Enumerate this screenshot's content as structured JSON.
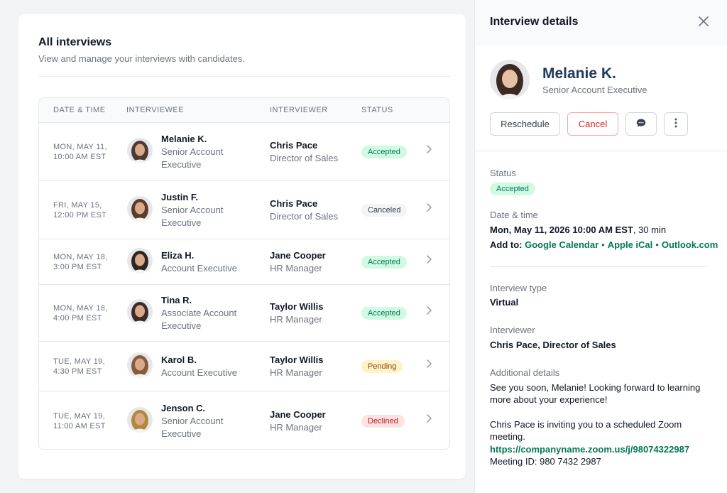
{
  "list": {
    "title": "All interviews",
    "subtitle": "View and manage your interviews with candidates.",
    "columns": [
      "DATE & TIME",
      "INTERVIEWEE",
      "INTERVIEWER",
      "STATUS"
    ],
    "rows": [
      {
        "date1": "MON, MAY 11,",
        "date2": "10:00 AM EST",
        "interviewee": "Melanie K.",
        "role1": "Senior Account",
        "role2": "Executive",
        "interviewer": "Chris Pace",
        "interviewer_role": "Director of Sales",
        "status": "Accepted",
        "avatar_bg": "#4b3a33"
      },
      {
        "date1": "FRI, MAY 15,",
        "date2": "12:00 PM EST",
        "interviewee": "Justin F.",
        "role1": "Senior Account",
        "role2": "Executive",
        "interviewer": "Chris Pace",
        "interviewer_role": "Director of Sales",
        "status": "Canceled",
        "avatar_bg": "#5b3b2a"
      },
      {
        "date1": "MON, MAY 18,",
        "date2": "3:00 PM EST",
        "interviewee": "Eliza H.",
        "role1": "Account Executive",
        "role2": "",
        "interviewer": "Jane Cooper",
        "interviewer_role": "HR Manager",
        "status": "Accepted",
        "avatar_bg": "#2f2522"
      },
      {
        "date1": "MON, MAY 18,",
        "date2": "4:00 PM EST",
        "interviewee": "Tina R.",
        "role1": "Associate Account",
        "role2": "Executive",
        "interviewer": "Taylor Willis",
        "interviewer_role": "HR Manager",
        "status": "Accepted",
        "avatar_bg": "#3a2d28"
      },
      {
        "date1": "TUE, MAY 19,",
        "date2": "4:30 PM EST",
        "interviewee": "Karol B.",
        "role1": "Account Executive",
        "role2": "",
        "interviewer": "Taylor Willis",
        "interviewer_role": "HR Manager",
        "status": "Pending",
        "avatar_bg": "#8a5a3c"
      },
      {
        "date1": "TUE, MAY 19,",
        "date2": "11:00 AM EST",
        "interviewee": "Jenson C.",
        "role1": "Senior Account",
        "role2": "Executive",
        "interviewer": "Jane Cooper",
        "interviewer_role": "HR Manager",
        "status": "Declined",
        "avatar_bg": "#b08a3a"
      }
    ]
  },
  "panel": {
    "title": "Interview details",
    "name": "Melanie K.",
    "role": "Senior Account Executive",
    "buttons": {
      "reschedule": "Reschedule",
      "cancel": "Cancel"
    },
    "status_label": "Status",
    "status_value": "Accepted",
    "datetime_label": "Date & time",
    "datetime_value": "Mon, May 11, 2026 10:00 AM EST",
    "duration": ", 30 min",
    "add_to_label": "Add to:",
    "calendars": [
      "Google Calendar",
      "Apple iCal",
      "Outlook.com"
    ],
    "type_label": "Interview type",
    "type_value": "Virtual",
    "interviewer_label": "Interviewer",
    "interviewer_value": "Chris Pace, Director of Sales",
    "details_label": "Additional details",
    "details_line1": "See you soon, Melanie! Looking forward to learning more about your experience!",
    "details_line2": "Chris Pace is inviting you to a scheduled Zoom meeting.",
    "zoom_link": "https://companyname.zoom.us/j/98074322987",
    "meeting_id": "Meeting ID: 980 7432 2987"
  },
  "colors": {
    "accent_green": "#047857",
    "name_blue": "#1e3a5f",
    "cancel_red": "#dc2626"
  },
  "icons": [
    "close-icon",
    "chat-icon",
    "more-vertical-icon",
    "chevron-right-icon",
    "avatar"
  ]
}
